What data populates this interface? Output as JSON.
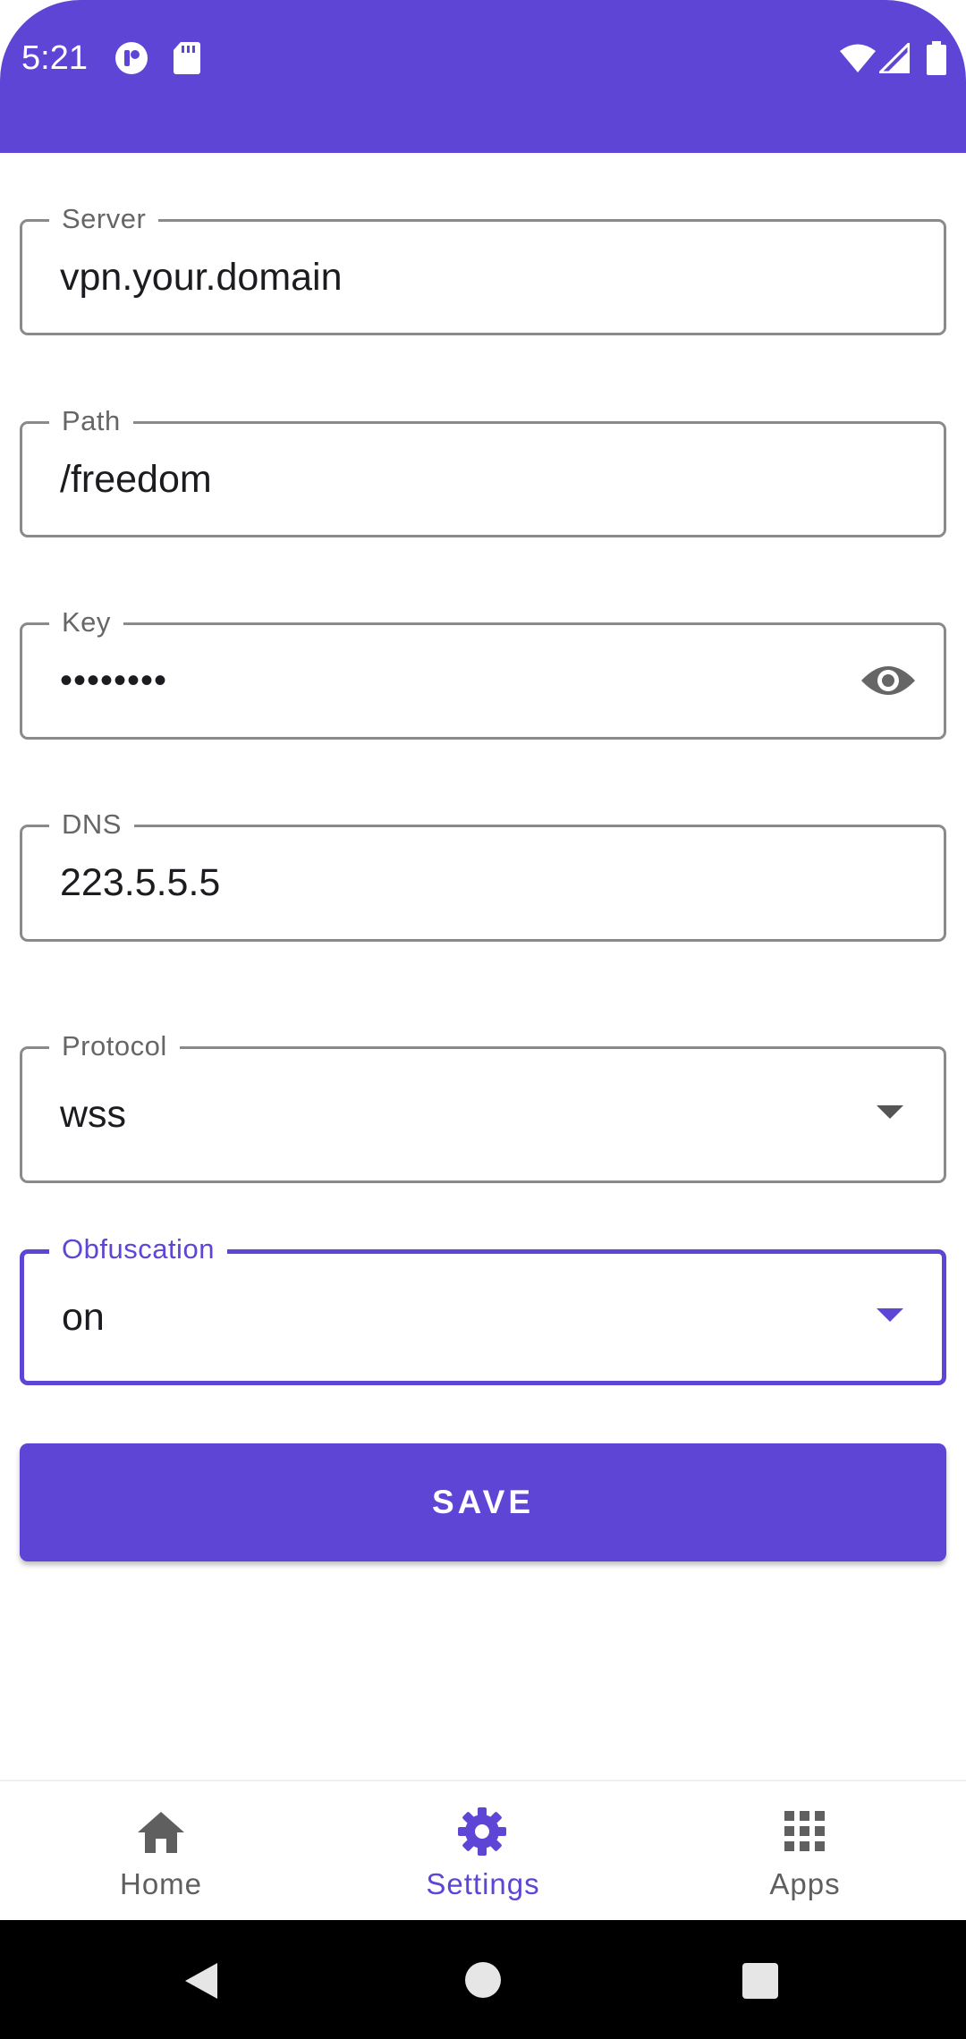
{
  "status_bar": {
    "time": "5:21",
    "left_icons": [
      "notification-app-icon",
      "sd-card-icon"
    ],
    "right_icons": [
      "wifi-icon",
      "cell-signal-icon",
      "battery-icon"
    ],
    "color": "#5e45d6"
  },
  "form": {
    "server": {
      "label": "Server",
      "value": "vpn.your.domain"
    },
    "path": {
      "label": "Path",
      "value": "/freedom"
    },
    "key": {
      "label": "Key",
      "value": "••••••••",
      "icon": "eye-icon"
    },
    "dns": {
      "label": "DNS",
      "value": "223.5.5.5"
    },
    "protocol": {
      "label": "Protocol",
      "value": "wss",
      "icon": "dropdown-arrow-icon"
    },
    "obfuscation": {
      "label": "Obfuscation",
      "value": "on",
      "icon": "dropdown-arrow-icon",
      "focused": true
    }
  },
  "save_button": {
    "label": "SAVE"
  },
  "bottom_nav": {
    "items": [
      {
        "label": "Home",
        "icon": "home-icon",
        "active": false
      },
      {
        "label": "Settings",
        "icon": "gear-icon",
        "active": true
      },
      {
        "label": "Apps",
        "icon": "grid-icon",
        "active": false
      }
    ],
    "active_color": "#5e45d6",
    "inactive_color": "#5f5f5f"
  },
  "system_nav": {
    "buttons": [
      "back-icon",
      "home-circle-icon",
      "recents-icon"
    ]
  }
}
